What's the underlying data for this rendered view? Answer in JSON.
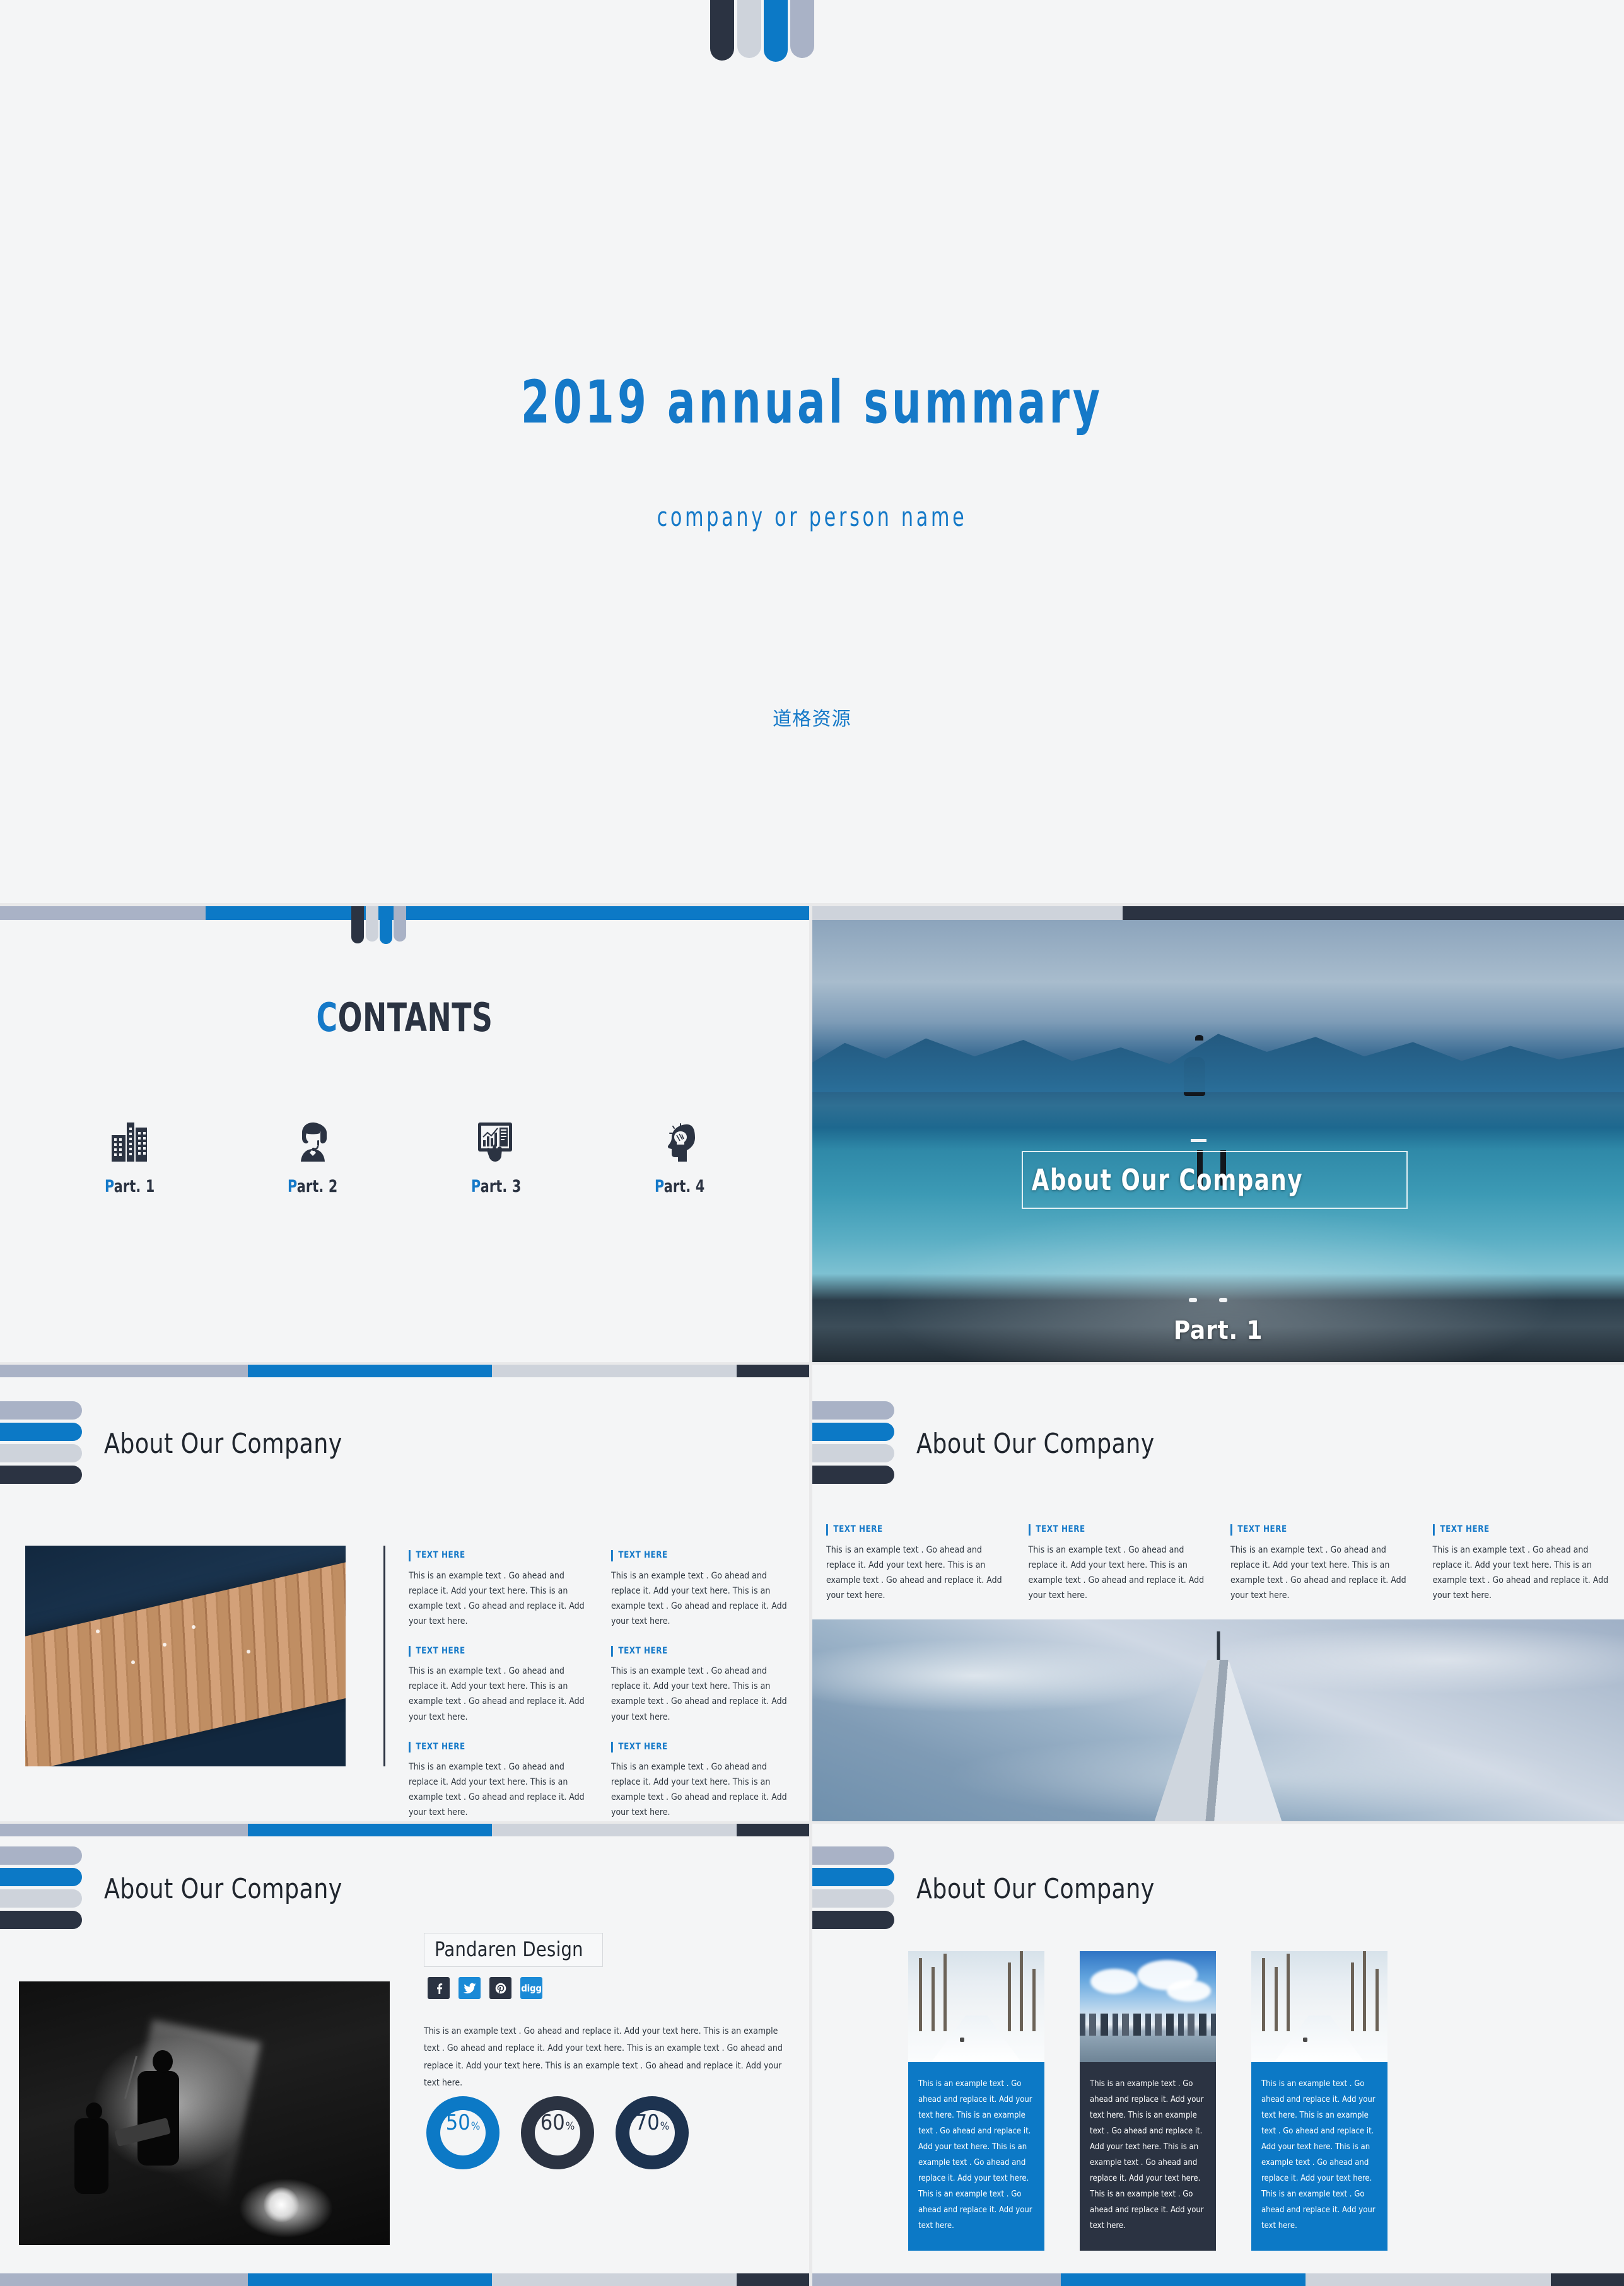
{
  "theme": {
    "blue": "#0c79c6",
    "navy": "#2b3342",
    "gray_blue": "#a9b2c6",
    "light_gray": "#ced3db",
    "page_bg": "#f4f5f6"
  },
  "slide_title": {
    "main": "2019 annual summary",
    "subtitle": "company or person name",
    "footer_cn": "道格资源",
    "logo_bars": [
      "navy",
      "light_gray",
      "blue",
      "gray_blue"
    ]
  },
  "slide_contents": {
    "heading_highlight": "C",
    "heading_rest": "ONTANTS",
    "parts": [
      {
        "icon": "office-building-icon",
        "label_highlight": "P",
        "label_rest": "art. 1"
      },
      {
        "icon": "support-agent-icon",
        "label_highlight": "P",
        "label_rest": "art. 2"
      },
      {
        "icon": "tablet-chart-icon",
        "label_highlight": "P",
        "label_rest": "art. 3"
      },
      {
        "icon": "idea-head-icon",
        "label_highlight": "P",
        "label_rest": "art. 4"
      }
    ]
  },
  "slide_part1": {
    "title": "About Our Company",
    "footer": "Part. 1",
    "photo": "man-looking-at-mountain-lake"
  },
  "slide_about_a": {
    "title": "About Our Company",
    "photo": "wooden-dock-over-dark-water",
    "blocks": [
      {
        "head": "TEXT HERE",
        "body": "This is an example text . Go ahead and replace it. Add your text here. This is an example text . Go ahead and replace it. Add your text here."
      },
      {
        "head": "TEXT HERE",
        "body": "This is an example text . Go ahead and replace it. Add your text here. This is an example text . Go ahead and replace it. Add your text here."
      },
      {
        "head": "TEXT HERE",
        "body": "This is an example text . Go ahead and replace it. Add your text here. This is an example text . Go ahead and replace it. Add your text here."
      },
      {
        "head": "TEXT HERE",
        "body": "This is an example text . Go ahead and replace it. Add your text here. This is an example text . Go ahead and replace it. Add your text here."
      },
      {
        "head": "TEXT HERE",
        "body": "This is an example text . Go ahead and replace it. Add your text here. This is an example text . Go ahead and replace it. Add your text here."
      },
      {
        "head": "TEXT HERE",
        "body": "This is an example text . Go ahead and replace it. Add your text here. This is an example text . Go ahead and replace it. Add your text here."
      }
    ]
  },
  "slide_about_b": {
    "title": "About Our Company",
    "photo": "skyscraper-tower-in-clouds",
    "blocks": [
      {
        "head": "TEXT HERE",
        "body": "This is an example text . Go ahead and replace it. Add your text here. This is an example text . Go ahead and replace it. Add your text here."
      },
      {
        "head": "TEXT HERE",
        "body": "This is an example text . Go ahead and replace it. Add your text here. This is an example text . Go ahead and replace it. Add your text here."
      },
      {
        "head": "TEXT HERE",
        "body": "This is an example text . Go ahead and replace it. Add your text here. This is an example text . Go ahead and replace it. Add your text here."
      },
      {
        "head": "TEXT HERE",
        "body": "This is an example text . Go ahead and replace it. Add your text here. This is an example text . Go ahead and replace it. Add your text here."
      }
    ]
  },
  "slide_about_c": {
    "title": "About Our Company",
    "photo": "live-band-on-stage-black-and-white",
    "brand": "Pandaren Design",
    "socials": [
      {
        "name": "facebook-icon",
        "color": "#2b3342"
      },
      {
        "name": "twitter-icon",
        "color": "#1b8ad6"
      },
      {
        "name": "pinterest-icon",
        "color": "#2b3342"
      },
      {
        "name": "digg-icon",
        "color": "#1b8ad6",
        "text": "digg"
      }
    ],
    "body": "This is an example text . Go ahead and replace it. Add your text here. This is an example text . Go ahead and replace it. Add your text here. This is an example text . Go ahead and replace it. Add your text here. This is an example text . Go ahead and replace it. Add your text here.",
    "stats": [
      {
        "value": "50",
        "unit": "%",
        "ring": "#0c79c6",
        "text_color": "#0c79c6"
      },
      {
        "value": "60",
        "unit": "%",
        "ring": "#2b3342",
        "text_color": "#2b3342"
      },
      {
        "value": "70",
        "unit": "%",
        "ring": "#1d3350",
        "text_color": "#1d3350"
      }
    ]
  },
  "slide_about_d": {
    "title": "About Our Company",
    "cards": [
      {
        "photo": "snowy-forest-road",
        "bg": "#0c79c6",
        "body": "This is an example text . Go ahead and replace it. Add your text here. This is an example text . Go ahead and replace it. Add your text here. This is an example text . Go ahead and replace it. Add your text here. This is an example text . Go ahead and replace it. Add your text here."
      },
      {
        "photo": "city-skyline-clouds",
        "bg": "#2b3342",
        "body": "This is an example text . Go ahead and replace it. Add your text here. This is an example text . Go ahead and replace it. Add your text here. This is an example text . Go ahead and replace it. Add your text here. This is an example text . Go ahead and replace it. Add your text here."
      },
      {
        "photo": "snowy-forest-road",
        "bg": "#0c79c6",
        "body": "This is an example text . Go ahead and replace it. Add your text here. This is an example text . Go ahead and replace it. Add your text here. This is an example text . Go ahead and replace it. Add your text here. This is an example text . Go ahead and replace it. Add your text here."
      }
    ]
  }
}
